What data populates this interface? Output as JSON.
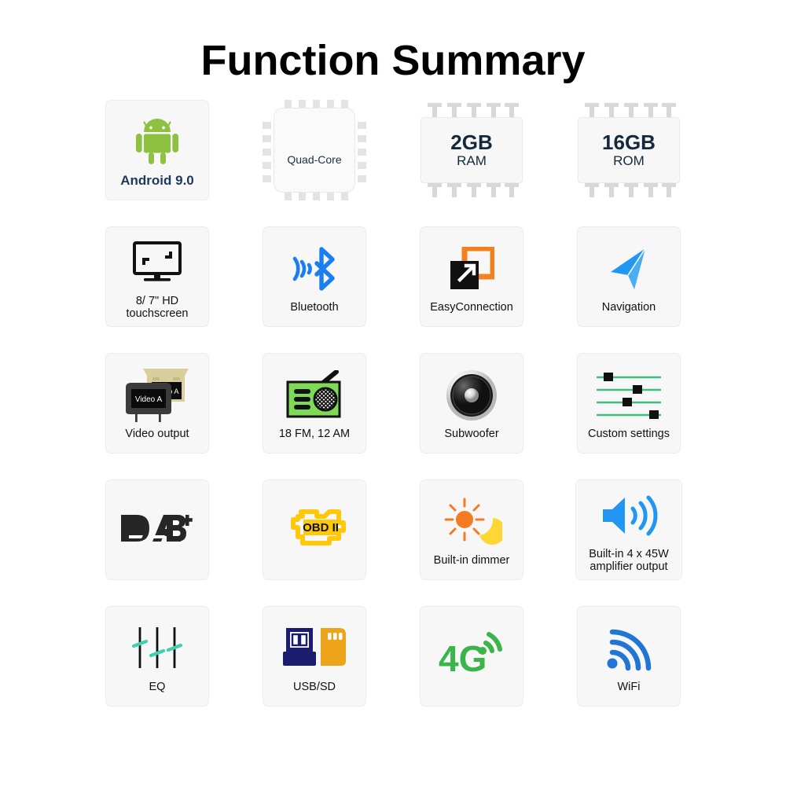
{
  "header": {
    "title": "Function Summary"
  },
  "grid": {
    "columns": 4,
    "rows": 5,
    "card_bg": "#f7f7f7",
    "card_border": "#ececec"
  },
  "features": [
    {
      "id": "android",
      "icon": "android-robot-icon",
      "label": "Android 9.0",
      "label_style": "navy",
      "colors": {
        "robot": "#8ec13f"
      }
    },
    {
      "id": "quad-core",
      "icon": "cpu-chip-icon",
      "label": "Quad-Core",
      "colors": {
        "chip": "#fafafa",
        "pin": "#e3e3e3"
      }
    },
    {
      "id": "ram",
      "icon": "memory-chip-icon",
      "size": "2GB",
      "kind": "RAM",
      "colors": {
        "text": "#14293c",
        "pin": "#d8d8d8"
      }
    },
    {
      "id": "rom",
      "icon": "memory-chip-icon",
      "size": "16GB",
      "kind": "ROM",
      "colors": {
        "text": "#14293c",
        "pin": "#d8d8d8"
      }
    },
    {
      "id": "touchscreen",
      "icon": "monitor-screen-icon",
      "label": "8/  7\" HD\ntouchscreen",
      "colors": {
        "icon": "#111111"
      }
    },
    {
      "id": "bluetooth",
      "icon": "bluetooth-icon",
      "label": "Bluetooth",
      "colors": {
        "icon": "#1a7ef0"
      }
    },
    {
      "id": "easyconnection",
      "icon": "easyconnection-icon",
      "label": "EasyConnection",
      "colors": {
        "front": "#111111",
        "back": "#f2801f"
      }
    },
    {
      "id": "navigation",
      "icon": "navigation-arrow-icon",
      "label": "Navigation",
      "colors": {
        "icon": "#2196f3"
      }
    },
    {
      "id": "video-output",
      "icon": "video-monitors-icon",
      "label": "Video output",
      "screen_text": "Video A",
      "colors": {
        "roof_monitor": "#d8cf9c",
        "headrest": "#3b3b3b",
        "screen": "#0b0b0b"
      }
    },
    {
      "id": "radio",
      "icon": "radio-icon",
      "label": "18 FM, 12 AM",
      "colors": {
        "body": "#7ed957",
        "outline": "#111111"
      }
    },
    {
      "id": "subwoofer",
      "icon": "speaker-cone-icon",
      "label": "Subwoofer",
      "colors": {
        "cone": "#2b2b2b",
        "ring": "#d9d9d9"
      }
    },
    {
      "id": "custom-settings",
      "icon": "sliders-icon",
      "label": "Custom settings",
      "slider_positions": [
        18,
        62,
        48,
        88
      ],
      "colors": {
        "track": "#3ec07b",
        "handle": "#111111"
      }
    },
    {
      "id": "dab",
      "icon": "dab-plus-logo-icon",
      "label": "",
      "colors": {
        "icon": "#262626"
      }
    },
    {
      "id": "obd",
      "icon": "obd-engine-icon",
      "label": "",
      "engine_text": "OBD II",
      "colors": {
        "icon": "#ffc80a"
      }
    },
    {
      "id": "dimmer",
      "icon": "sun-moon-icon",
      "label": "Built-in dimmer",
      "colors": {
        "sun": "#f57b20",
        "moon": "#ffd633"
      }
    },
    {
      "id": "amplifier",
      "icon": "speaker-waves-icon",
      "label": "Built-in 4 x 45W\namplifier output",
      "colors": {
        "icon": "#2196f3"
      }
    },
    {
      "id": "eq",
      "icon": "equalizer-icon",
      "label": "EQ",
      "colors": {
        "line": "#111111",
        "handle": "#3fd0b0"
      }
    },
    {
      "id": "usb-sd",
      "icon": "usb-sd-icon",
      "label": "USB/SD",
      "colors": {
        "usb": "#1b1b6f",
        "sd": "#eda31a"
      }
    },
    {
      "id": "4g",
      "icon": "four-g-signal-icon",
      "label": "",
      "badge_text": "4G",
      "colors": {
        "icon": "#3bb54a"
      }
    },
    {
      "id": "wifi",
      "icon": "wifi-icon",
      "label": "WiFi",
      "colors": {
        "icon": "#2275d4"
      }
    }
  ]
}
